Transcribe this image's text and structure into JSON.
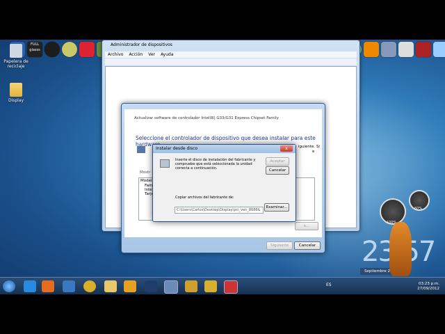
{
  "desktop": {
    "recycle_label": "Papelera de reciclaje",
    "folder_label": "Display",
    "launch_bar_label": "FULL glasss"
  },
  "device_manager": {
    "title": "Administrador de dispositivos",
    "menu": [
      "Archivo",
      "Acción",
      "Ver",
      "Ayuda"
    ]
  },
  "wizard": {
    "path_title": "Actualizar software de controlador Intel(R) G33/G31 Express Chipset Family",
    "heading": "Seleccione el controlador de dispositivo que desea instalar para este hardware.",
    "right_fragment_1": "iguiente. Si",
    "right_fragment_2": "e",
    "show_compat_label": "Mostr",
    "model_header": "Modelo",
    "list_items": [
      "Famil",
      "Intel",
      "Tarje"
    ],
    "disk_button_fragment": "o...",
    "next_label": "Siguiente",
    "cancel_label": "Cancelar"
  },
  "install_disk": {
    "title": "Instalar desde disco",
    "close_glyph": "x",
    "instructions": "Inserte el disco de instalación del fabricante y compruebe que está seleccionada la unidad correcta a continuación.",
    "accept_label": "Aceptar",
    "cancel_label": "Cancelar",
    "copy_label": "Copiar archivos del fabricante de:",
    "path_value": "C:\\Users\\Carlos\\Desktop\\Display\\pci_ven_8086&",
    "browse_label": "Examinar..."
  },
  "taskbar": {
    "language": "ES",
    "time": "03:23 p.m.",
    "date": "27/09/2012"
  },
  "gadgets": {
    "clock_text": "23:57",
    "calendar_fragment": "Septiembre 2",
    "gauge_value_1": "100%",
    "gauge_value_2": "60%"
  },
  "colors": {
    "accent": "#1e3a8a",
    "close_red": "#c7382a"
  }
}
